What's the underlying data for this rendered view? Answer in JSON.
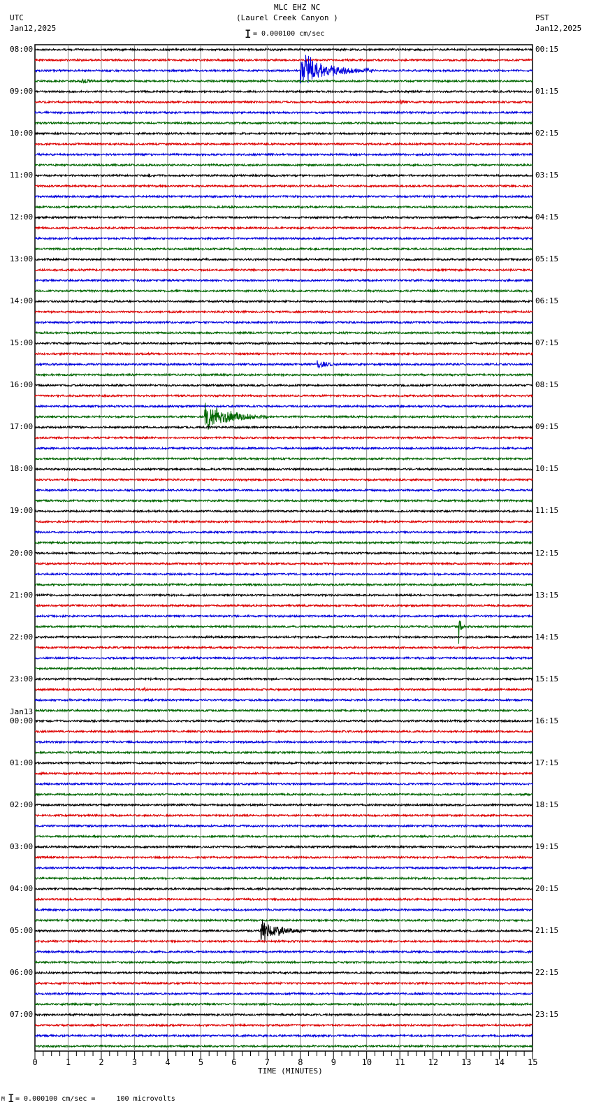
{
  "header": {
    "title": "MLC EHZ NC",
    "subtitle": "(Laurel Creek Canyon )",
    "scale": "= 0.000100 cm/sec",
    "left_tz": "UTC",
    "left_date": "Jan12,2025",
    "right_tz": "PST",
    "right_date": "Jan12,2025"
  },
  "footer": {
    "scale_note": "= 0.000100 cm/sec =     100 microvolts",
    "mark": "M"
  },
  "chart_data": {
    "type": "line",
    "title": "MLC EHZ NC (Laurel Creek Canyon )",
    "xlabel": "TIME (MINUTES)",
    "xlim": [
      0,
      15
    ],
    "x_ticks": [
      "0",
      "1",
      "2",
      "3",
      "4",
      "5",
      "6",
      "7",
      "8",
      "9",
      "10",
      "11",
      "12",
      "13",
      "14",
      "15"
    ],
    "traces_per_hour": 4,
    "trace_count": 96,
    "trace_colors": [
      "#000000",
      "#dd0000",
      "#0000dd",
      "#006600"
    ],
    "left_labels": [
      "08:00",
      "09:00",
      "10:00",
      "11:00",
      "12:00",
      "13:00",
      "14:00",
      "15:00",
      "16:00",
      "17:00",
      "18:00",
      "19:00",
      "20:00",
      "21:00",
      "22:00",
      "23:00",
      "00:00",
      "01:00",
      "02:00",
      "03:00",
      "04:00",
      "05:00",
      "06:00",
      "07:00"
    ],
    "date_change_label": "Jan13",
    "right_labels": [
      "00:15",
      "01:15",
      "02:15",
      "03:15",
      "04:15",
      "05:15",
      "06:15",
      "07:15",
      "08:15",
      "09:15",
      "10:15",
      "11:15",
      "12:15",
      "13:15",
      "14:15",
      "15:15",
      "16:15",
      "17:15",
      "18:15",
      "19:15",
      "20:15",
      "21:15",
      "22:15",
      "23:15"
    ],
    "events": [
      {
        "trace": 2,
        "minute": 8.0,
        "duration": 2.2,
        "amplitude": 30
      },
      {
        "trace": 3,
        "minute": 1.4,
        "duration": 0.6,
        "amplitude": 3
      },
      {
        "trace": 5,
        "minute": 11.0,
        "duration": 0.4,
        "amplitude": 4
      },
      {
        "trace": 12,
        "minute": 3.4,
        "duration": 0.2,
        "amplitude": 3
      },
      {
        "trace": 30,
        "minute": 8.5,
        "duration": 0.6,
        "amplitude": 9
      },
      {
        "trace": 35,
        "minute": 5.1,
        "duration": 1.9,
        "amplitude": 30
      },
      {
        "trace": 55,
        "minute": 12.75,
        "duration": 0.2,
        "amplitude": 35
      },
      {
        "trace": 61,
        "minute": 3.3,
        "duration": 0.1,
        "amplitude": 4
      },
      {
        "trace": 84,
        "minute": 6.8,
        "duration": 1.3,
        "amplitude": 22
      }
    ]
  }
}
